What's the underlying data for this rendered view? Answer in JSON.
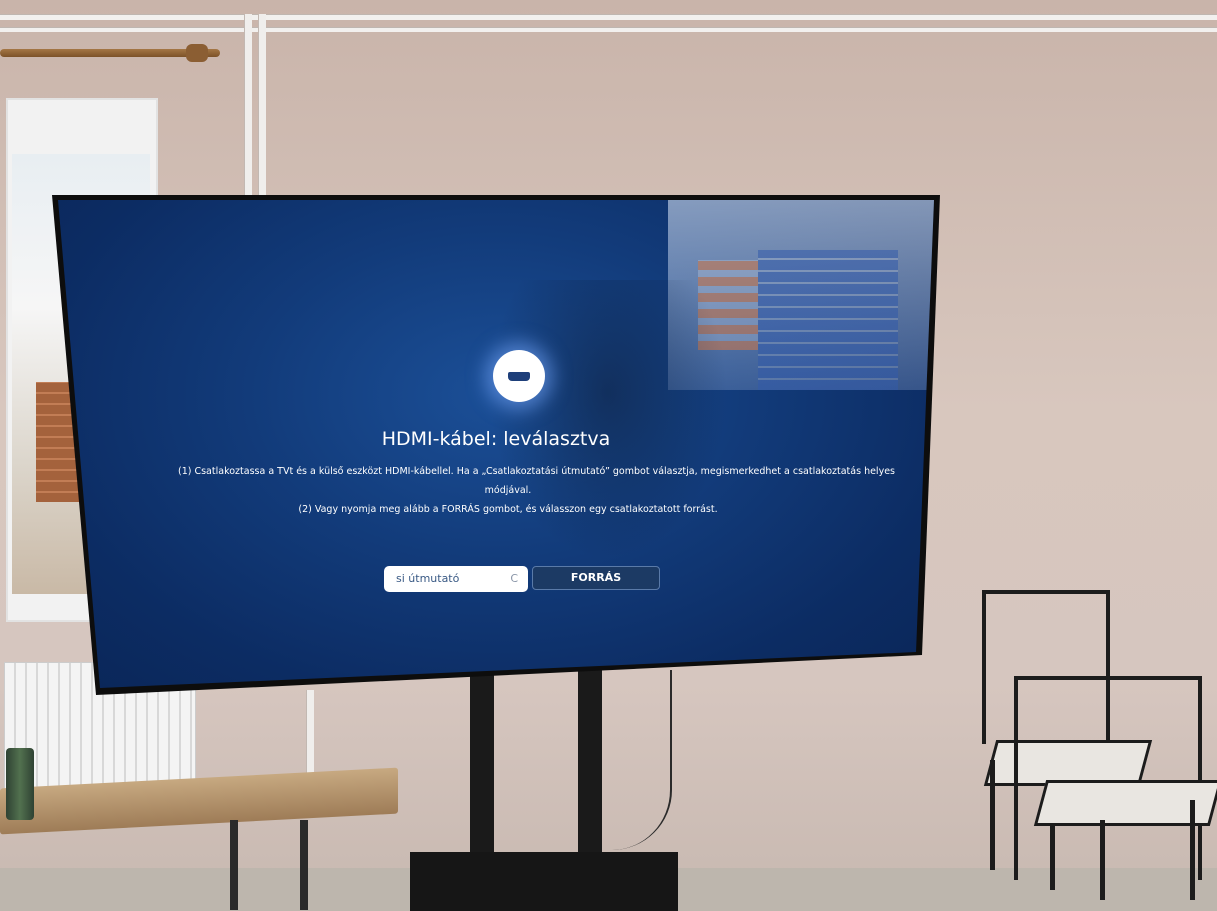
{
  "screen": {
    "title": "HDMI-kábel: leválasztva",
    "message_line1": "(1) Csatlakoztassa a TVt és a külső eszközt HDMI-kábellel. Ha a „Csatlakoztatási útmutató” gombot választja, megismerkedhet a csatlakoztatás helyes",
    "message_line2": "módjával.",
    "message_line3": "(2) Vagy nyomja meg alább a FORRÁS gombot, és válasszon egy csatlakoztatott forrást.",
    "guide_button_label": "si útmutató",
    "guide_button_tail": "C",
    "source_button_label": "FORRÁS"
  },
  "icons": {
    "connector": "hdmi-icon"
  },
  "colors": {
    "screen_bg": "#123b7a",
    "text": "#ffffff",
    "guide_button_bg": "#ffffff",
    "source_button_bg": "#1c3a64"
  }
}
